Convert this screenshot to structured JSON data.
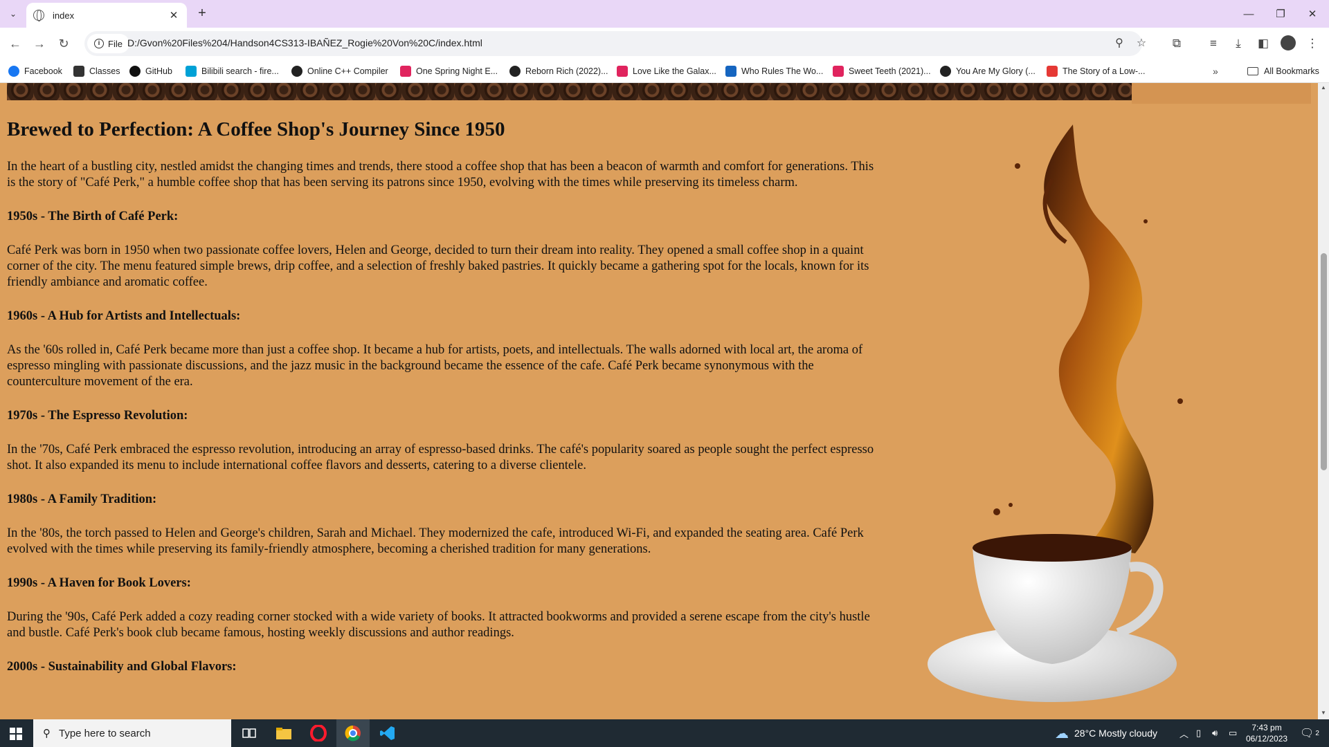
{
  "browser": {
    "tab_title": "index",
    "url_chip": "File",
    "url": "D:/Gvon%20Files%204/Handson4CS313-IBAÑEZ_Rogie%20Von%20C/index.html",
    "bookmarks": [
      {
        "label": "Facebook",
        "color": "#1877f2"
      },
      {
        "label": "Classes",
        "color": "#333333"
      },
      {
        "label": "GitHub",
        "color": "#111111"
      },
      {
        "label": "Bilibili search - fire...",
        "color": "#00a1d6"
      },
      {
        "label": "Online C++ Compiler",
        "color": "#222222"
      },
      {
        "label": "One Spring Night E...",
        "color": "#e0245e"
      },
      {
        "label": "Reborn Rich (2022)...",
        "color": "#222222"
      },
      {
        "label": "Love Like the Galax...",
        "color": "#e0245e"
      },
      {
        "label": "Who Rules The Wo...",
        "color": "#1565c0"
      },
      {
        "label": "Sweet Teeth (2021)...",
        "color": "#e0245e"
      },
      {
        "label": "You Are My Glory (...",
        "color": "#222222"
      },
      {
        "label": "The Story of a Low-...",
        "color": "#e53935"
      }
    ],
    "all_bookmarks": "All Bookmarks"
  },
  "article": {
    "title": "Brewed to Perfection: A Coffee Shop's Journey Since 1950",
    "intro": "In the heart of a bustling city, nestled amidst the changing times and trends, there stood a coffee shop that has been a beacon of warmth and comfort for generations. This is the story of \"Café Perk,\" a humble coffee shop that has been serving its patrons since 1950, evolving with the times while preserving its timeless charm.",
    "sections": [
      {
        "heading": "1950s - The Birth of Café Perk:",
        "body": "Café Perk was born in 1950 when two passionate coffee lovers, Helen and George, decided to turn their dream into reality. They opened a small coffee shop in a quaint corner of the city. The menu featured simple brews, drip coffee, and a selection of freshly baked pastries. It quickly became a gathering spot for the locals, known for its friendly ambiance and aromatic coffee."
      },
      {
        "heading": "1960s - A Hub for Artists and Intellectuals:",
        "body": "As the '60s rolled in, Café Perk became more than just a coffee shop. It became a hub for artists, poets, and intellectuals. The walls adorned with local art, the aroma of espresso mingling with passionate discussions, and the jazz music in the background became the essence of the cafe. Café Perk became synonymous with the counterculture movement of the era."
      },
      {
        "heading": "1970s - The Espresso Revolution:",
        "body": "In the '70s, Café Perk embraced the espresso revolution, introducing an array of espresso-based drinks. The café's popularity soared as people sought the perfect espresso shot. It also expanded its menu to include international coffee flavors and desserts, catering to a diverse clientele."
      },
      {
        "heading": "1980s - A Family Tradition:",
        "body": "In the '80s, the torch passed to Helen and George's children, Sarah and Michael. They modernized the cafe, introduced Wi-Fi, and expanded the seating area. Café Perk evolved with the times while preserving its family-friendly atmosphere, becoming a cherished tradition for many generations."
      },
      {
        "heading": "1990s - A Haven for Book Lovers:",
        "body": "During the '90s, Café Perk added a cozy reading corner stocked with a wide variety of books. It attracted bookworms and provided a serene escape from the city's hustle and bustle. Café Perk's book club became famous, hosting weekly discussions and author readings."
      },
      {
        "heading": "2000s - Sustainability and Global Flavors:",
        "body": ""
      }
    ]
  },
  "taskbar": {
    "search_placeholder": "Type here to search",
    "weather": "28°C  Mostly cloudy",
    "time": "7:43 pm",
    "date": "06/12/2023",
    "notification_count": "2"
  },
  "colors": {
    "page_bg": "#dc9f5c",
    "tabbar_bg": "#e9d7f7",
    "taskbar_bg": "#1f2a33"
  }
}
